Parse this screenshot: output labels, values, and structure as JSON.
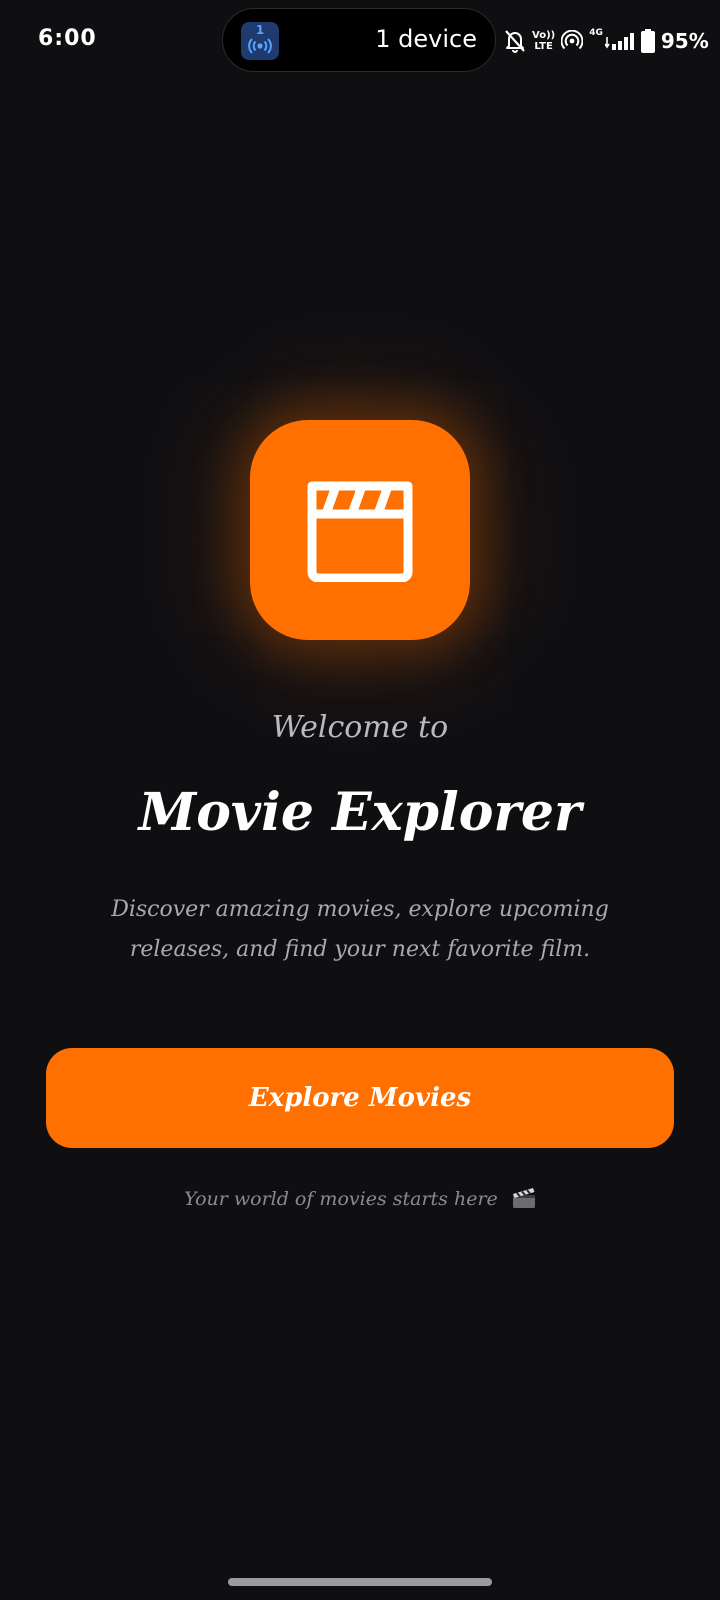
{
  "status_bar": {
    "time": "6:00",
    "island": {
      "app_badge": "1",
      "label": "1 device"
    },
    "volte_top": "Vo))",
    "volte_bottom": "LTE",
    "network": "4G",
    "battery_percent": "95%",
    "icons": [
      "bell-off-icon",
      "volte-icon",
      "hotspot-icon",
      "signal-icon",
      "battery-icon"
    ]
  },
  "hero": {
    "logo_icon": "clapperboard-icon",
    "welcome": "Welcome to",
    "title": "Movie Explorer",
    "description": "Discover amazing movies, explore upcoming releases, and find your next favorite film."
  },
  "cta": {
    "label": "Explore Movies"
  },
  "tagline": {
    "text": "Your world of movies starts here",
    "icon": "clapper-emoji-icon"
  },
  "colors": {
    "background": "#0f0f12",
    "accent": "#ff7000",
    "text_primary": "#ffffff",
    "text_secondary": "#a9a9ae"
  }
}
